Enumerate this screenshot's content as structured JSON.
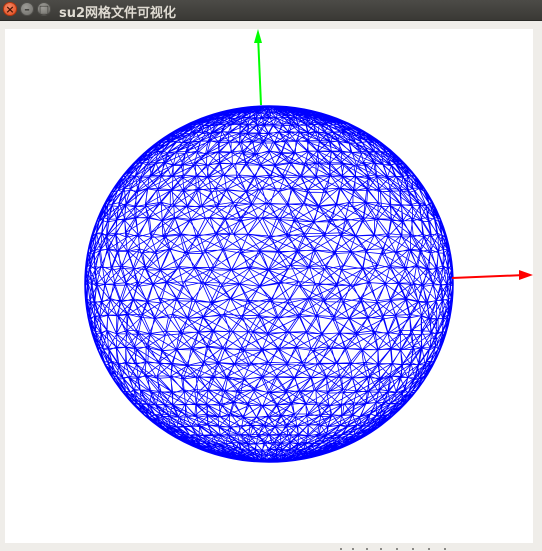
{
  "window": {
    "title": "su2网格文件可视化",
    "controls": {
      "close_icon": "close-icon",
      "minimize_icon": "minimize-icon",
      "maximize_icon": "maximize-icon"
    }
  },
  "viewport": {
    "background": "#ffffff",
    "mesh_color": "#0000ff",
    "x_axis_color": "#ff0000",
    "y_axis_color": "#00ff00"
  }
}
